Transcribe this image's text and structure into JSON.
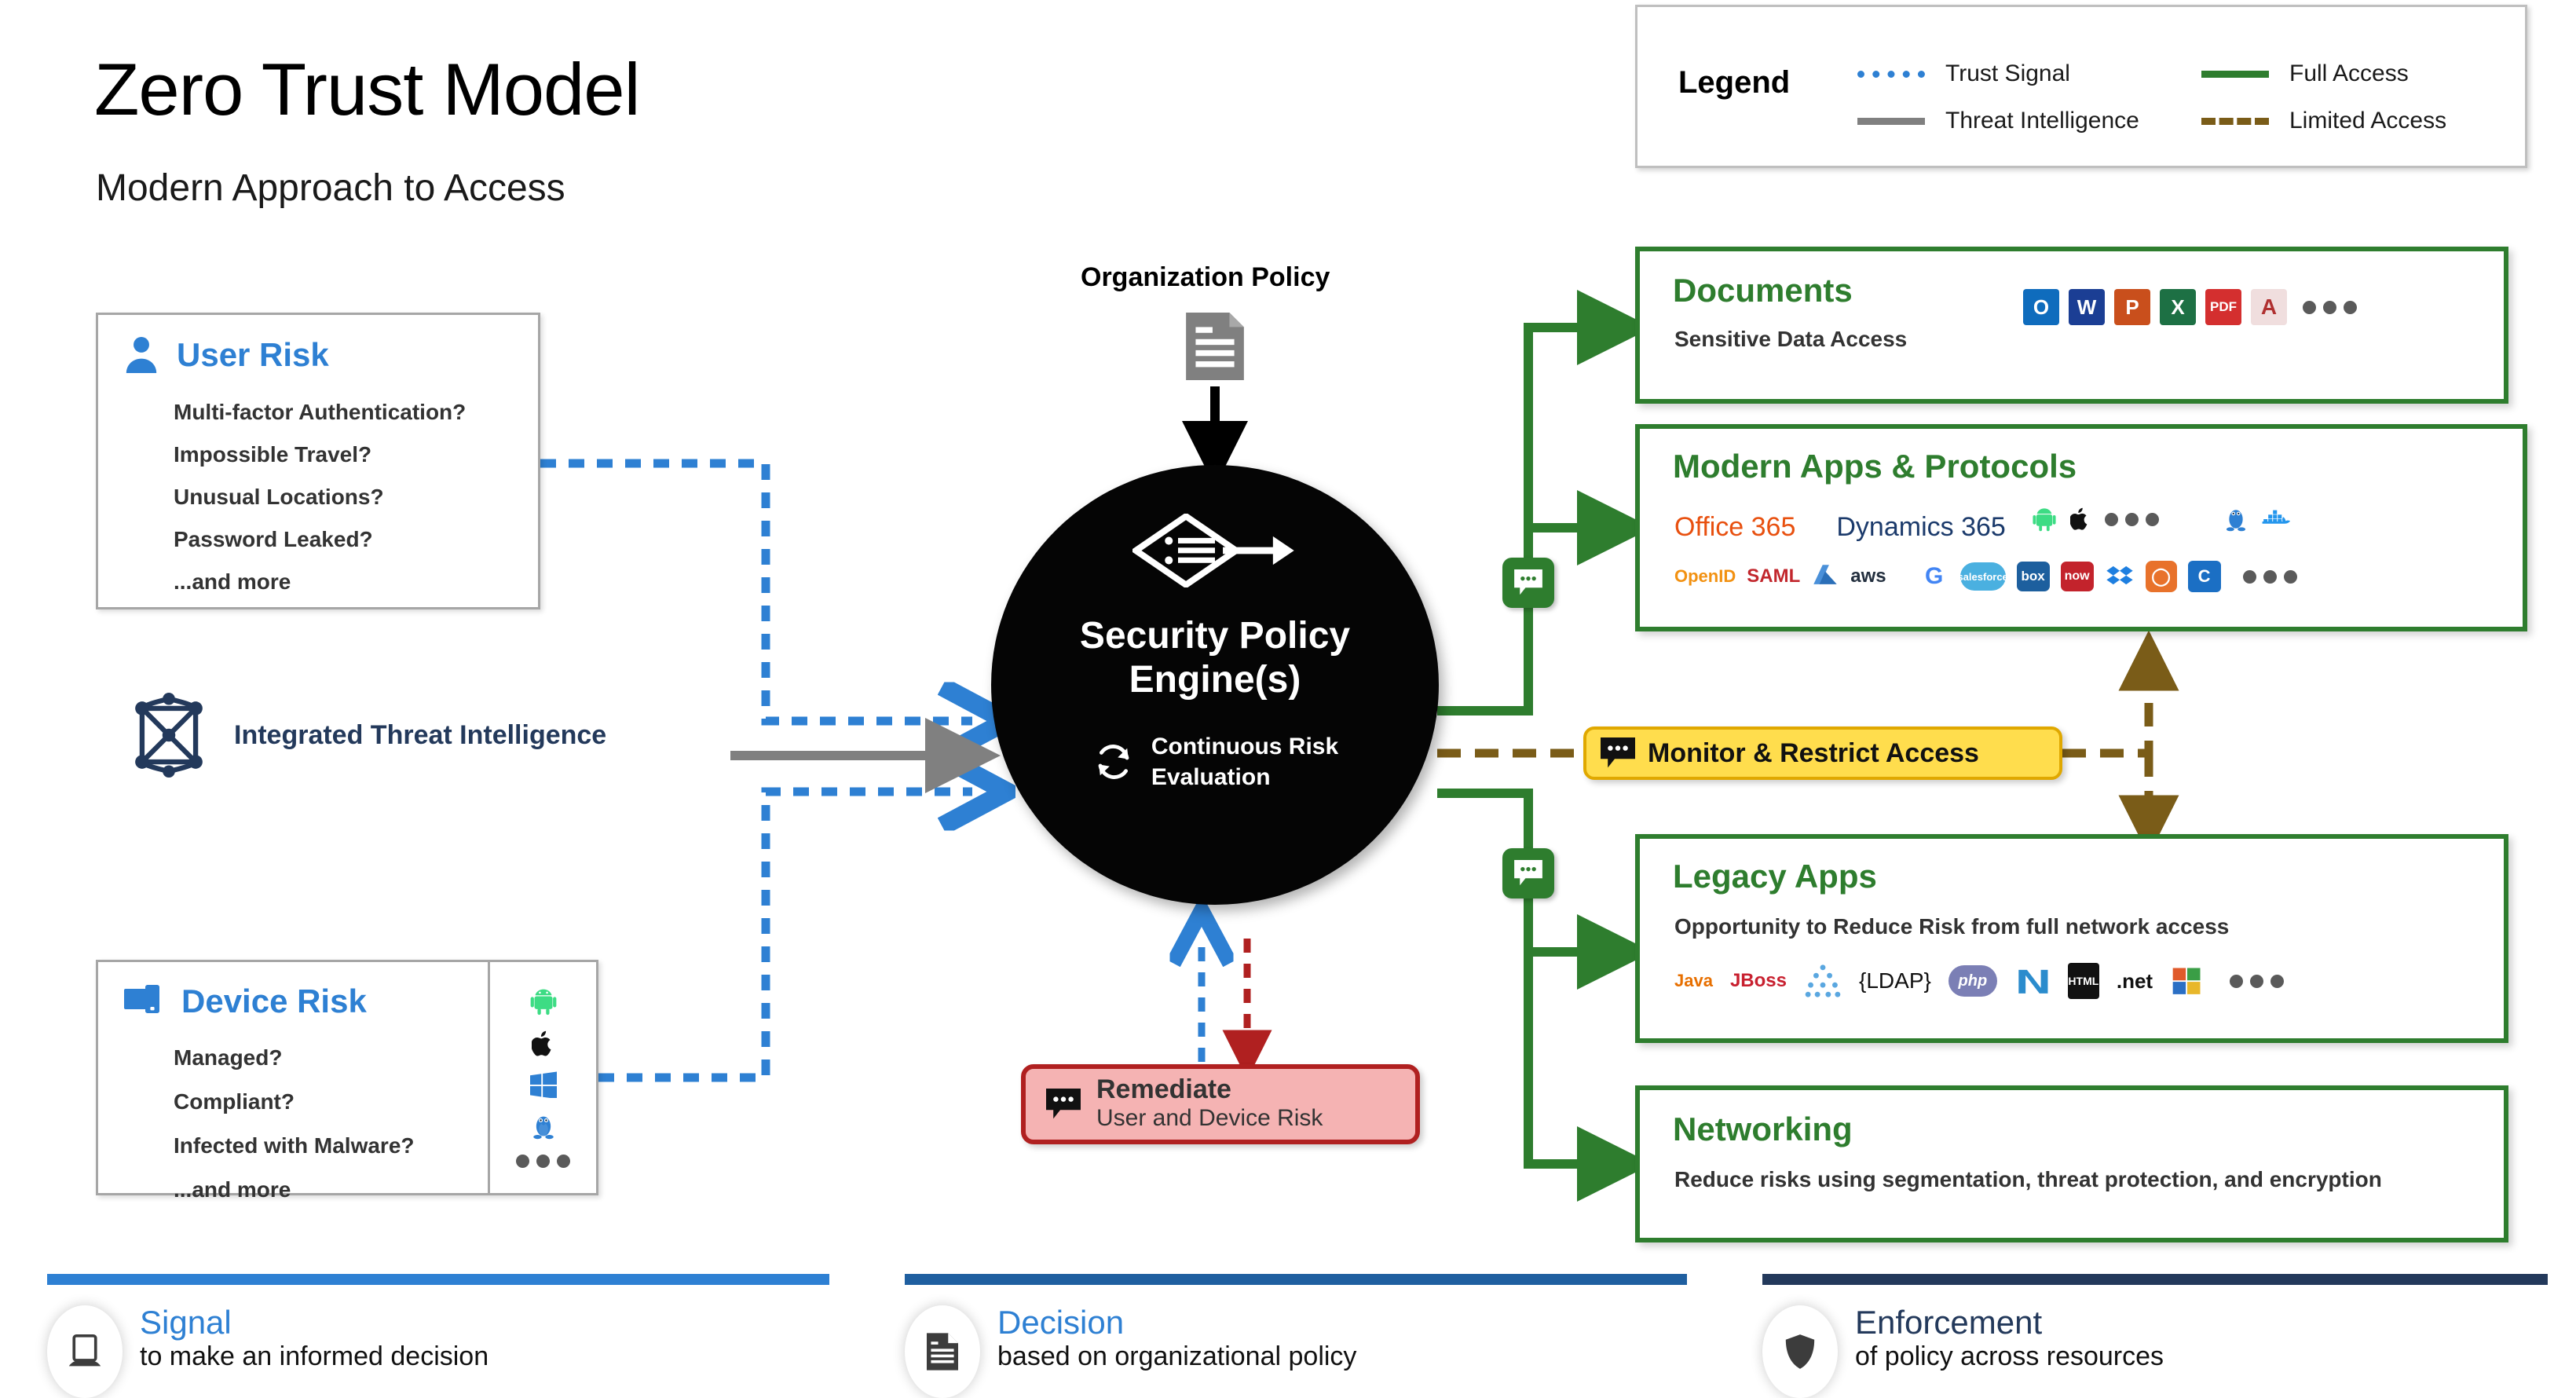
{
  "header": {
    "title": "Zero Trust Model",
    "subtitle": "Modern Approach to Access"
  },
  "legend": {
    "title": "Legend",
    "items": [
      {
        "label": "Trust Signal",
        "style": "dotted",
        "color": "#2e80d3"
      },
      {
        "label": "Threat Intelligence",
        "style": "solid",
        "color": "#808080"
      },
      {
        "label": "Full Access",
        "style": "solid",
        "color": "#2e7d2e"
      },
      {
        "label": "Limited Access",
        "style": "dashed",
        "color": "#7a5c18"
      }
    ]
  },
  "user_risk": {
    "title": "User Risk",
    "icon": "person-icon",
    "items": [
      "Multi-factor Authentication?",
      "Impossible Travel?",
      "Unusual Locations?",
      "Password Leaked?",
      "...and more"
    ]
  },
  "device_risk": {
    "title": "Device Risk",
    "icon": "devices-icon",
    "items": [
      "Managed?",
      "Compliant?",
      "Infected with Malware?",
      "...and more"
    ],
    "platforms": [
      "android-icon",
      "apple-icon",
      "windows-icon",
      "linux-icon",
      "more-dots-icon"
    ]
  },
  "threat_intelligence": {
    "label": "Integrated Threat Intelligence",
    "icon": "network-graph-icon"
  },
  "organization_policy": {
    "label": "Organization Policy",
    "icon": "policy-document-icon"
  },
  "core": {
    "icon": "decision-flow-icon",
    "title_line1": "Security Policy",
    "title_line2": "Engine(s)",
    "sub_icon": "refresh-cycle-icon",
    "sub_line1": "Continuous Risk",
    "sub_line2": "Evaluation"
  },
  "monitor_badge": {
    "label": "Monitor & Restrict Access",
    "icon": "comment-icon",
    "bg_color": "#ffdd4d",
    "border_color": "#e0a800"
  },
  "remediate": {
    "title": "Remediate",
    "subtitle": "User and Device Risk",
    "icon": "comment-icon",
    "bg_color": "#f5b3b3",
    "border_color": "#b02020"
  },
  "panels": {
    "documents": {
      "title": "Documents",
      "subtitle": "Sensitive Data Access",
      "apps": [
        "outlook",
        "word",
        "powerpoint",
        "excel",
        "pdf",
        "autocad",
        "more-dots-icon"
      ]
    },
    "modern_apps": {
      "title": "Modern Apps & Protocols",
      "brands": [
        "Office 365",
        "Dynamics 365"
      ],
      "platforms": [
        "android-icon",
        "apple-icon",
        "more-dots-icon",
        "linux-icon",
        "docker-icon"
      ],
      "services": [
        "OpenID Connect",
        "SAML",
        "Azure",
        "aws",
        "Google",
        "salesforce",
        "box",
        "now",
        "Dropbox",
        "Okta",
        "Concur",
        "more-dots-icon"
      ]
    },
    "legacy_apps": {
      "title": "Legacy Apps",
      "subtitle": "Opportunity to Reduce Risk from full network access",
      "stack": [
        "Java",
        "JBoss",
        "LDAP-cluster",
        "{LDAP}",
        "php",
        "Microsoft .NET",
        "HTML",
        "Microsoft .net",
        "Windows",
        "more-dots-icon"
      ]
    },
    "networking": {
      "title": "Networking",
      "subtitle": "Reduce risks using segmentation, threat protection, and encryption"
    }
  },
  "footer": {
    "columns": [
      {
        "title": "Signal",
        "subtitle": "to make an informed decision",
        "icon": "laptop-icon",
        "bar_color": "#2e80d3"
      },
      {
        "title": "Decision",
        "subtitle": "based on organizational policy",
        "icon": "document-icon",
        "bar_color": "#1f5fa0"
      },
      {
        "title": "Enforcement",
        "subtitle": "of policy across resources",
        "icon": "shield-icon",
        "bar_color": "#23395b"
      }
    ]
  }
}
